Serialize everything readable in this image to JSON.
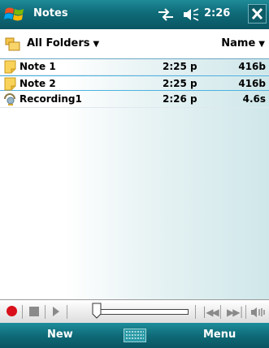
{
  "titlebar": {
    "app_title": "Notes",
    "clock": "2:26",
    "start_icon": "windows-flag-icon",
    "connectivity_icon": "connectivity-icon",
    "volume_icon": "speaker-icon",
    "close_icon": "close-icon"
  },
  "folderbar": {
    "folder_label": "All Folders",
    "sort_label": "Name"
  },
  "files": [
    {
      "name": "Note 1",
      "time": "2:25 p",
      "size": "416b",
      "icon": "note-icon",
      "selected": false
    },
    {
      "name": "Note 2",
      "time": "2:25 p",
      "size": "416b",
      "icon": "note-icon",
      "selected": true
    },
    {
      "name": "Recording1",
      "time": "2:26 p",
      "size": "4.6s",
      "icon": "recording-icon",
      "selected": false
    }
  ],
  "recorder": {
    "record_icon": "record-icon",
    "stop_icon": "stop-icon",
    "play_icon": "play-icon",
    "prev_icon": "skip-back-icon",
    "next_icon": "skip-forward-icon",
    "volume_icon": "volume-icon"
  },
  "softkeys": {
    "left": "New",
    "right": "Menu",
    "keyboard_icon": "keyboard-icon"
  },
  "colors": {
    "title_bar": "#0f6b78",
    "selection": "#4bb2e0",
    "record": "#d9101b"
  }
}
